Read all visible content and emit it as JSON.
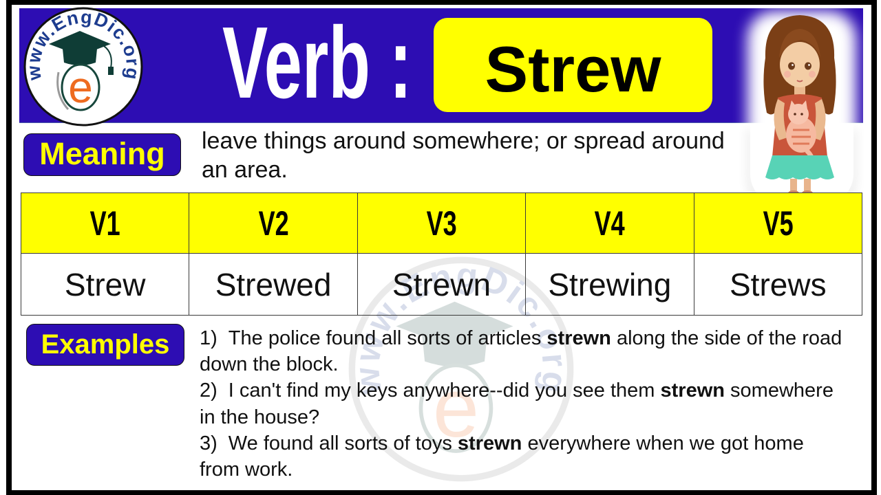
{
  "logo": {
    "text": "www.EngDic.org"
  },
  "header": {
    "title": "Verb :",
    "word": "Strew"
  },
  "meaning": {
    "label": "Meaning",
    "lines": [
      "leave things around somewhere; or spread around",
      "an area."
    ]
  },
  "forms": {
    "headers": [
      "V1",
      "V2",
      "V3",
      "V4",
      "V5"
    ],
    "values": [
      "Strew",
      "Strewed",
      "Strewn",
      "Strewing",
      "Strews"
    ]
  },
  "examples": {
    "label": "Examples",
    "items": [
      {
        "number": "1)",
        "text_before": "The police found all sorts of articles ",
        "keyword": "strewn",
        "text_after": " along the side of the road",
        "continuation": "down the block."
      },
      {
        "number": "2)",
        "text_before": "I can't find my keys anywhere--did you see them ",
        "keyword": "strewn",
        "text_after": " somewhere",
        "continuation": "in the house?"
      },
      {
        "number": "3)",
        "text_before": "We found all sorts of toys ",
        "keyword": "strewn",
        "text_after": " everywhere when we got home",
        "continuation": "from work."
      }
    ]
  },
  "colors": {
    "banner": "#2d0db3",
    "highlight": "#ffff00",
    "label_text": "#ffff00",
    "logo_text": "#1d3c8f",
    "logo_cap": "#0f3d36",
    "logo_e": "#ee6b20"
  }
}
